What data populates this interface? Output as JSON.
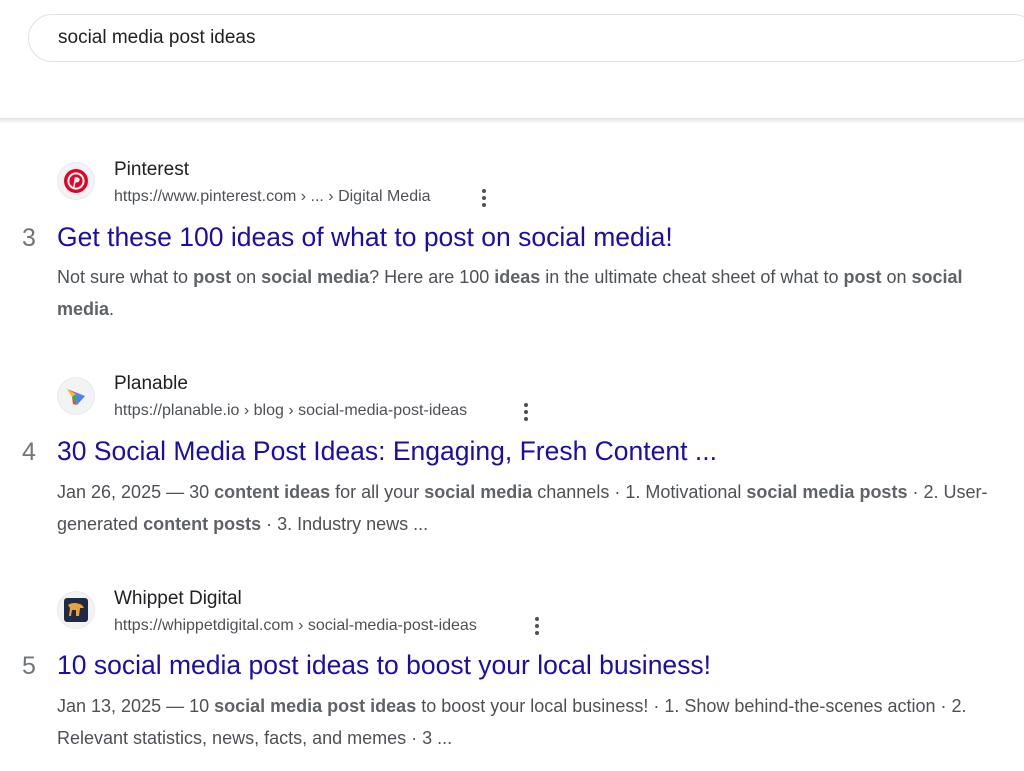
{
  "search": {
    "query": "social media post ideas"
  },
  "results": [
    {
      "rank": "3",
      "favicon_icon": "pinterest-logo-icon",
      "site_name": "Pinterest",
      "url": "https://www.pinterest.com › ... › Digital Media",
      "title": "Get these 100 ideas of what to post on social media!",
      "snippet": [
        {
          "t": "Not sure what to ",
          "b": false
        },
        {
          "t": "post",
          "b": true
        },
        {
          "t": " on ",
          "b": false
        },
        {
          "t": "social media",
          "b": true
        },
        {
          "t": "? Here are 100 ",
          "b": false
        },
        {
          "t": "ideas",
          "b": true
        },
        {
          "t": " in the ultimate cheat sheet of what to ",
          "b": false
        },
        {
          "t": "post",
          "b": true
        },
        {
          "t": " on ",
          "b": false
        },
        {
          "t": "social media",
          "b": true
        },
        {
          "t": ".",
          "b": false
        }
      ]
    },
    {
      "rank": "4",
      "favicon_icon": "planable-logo-icon",
      "site_name": "Planable",
      "url": "https://planable.io › blog › social-media-post-ideas",
      "title": "30 Social Media Post Ideas: Engaging, Fresh Content ...",
      "snippet": [
        {
          "t": "Jan 26, 2025 — 30 ",
          "b": false
        },
        {
          "t": "content ideas",
          "b": true
        },
        {
          "t": " for all your ",
          "b": false
        },
        {
          "t": "social media",
          "b": true
        },
        {
          "t": " channels · 1. Motivational ",
          "b": false
        },
        {
          "t": "social media posts",
          "b": true
        },
        {
          "t": " · 2. User-generated ",
          "b": false
        },
        {
          "t": "content posts",
          "b": true
        },
        {
          "t": " · 3. Industry news ...",
          "b": false
        }
      ]
    },
    {
      "rank": "5",
      "favicon_icon": "whippet-digital-logo-icon",
      "site_name": "Whippet Digital",
      "url": "https://whippetdigital.com › social-media-post-ideas",
      "title": "10 social media post ideas to boost your local business!",
      "snippet": [
        {
          "t": "Jan 13, 2025 — 10 ",
          "b": false
        },
        {
          "t": "social media post ideas",
          "b": true
        },
        {
          "t": " to boost your local business! · 1. Show behind-the-scenes action · 2. Relevant statistics, news, facts, and memes · 3 ...",
          "b": false
        }
      ]
    }
  ],
  "colors": {
    "title_link": "#1a0dab",
    "snippet_text": "#4d5156",
    "pinterest_red": "#e60023"
  }
}
